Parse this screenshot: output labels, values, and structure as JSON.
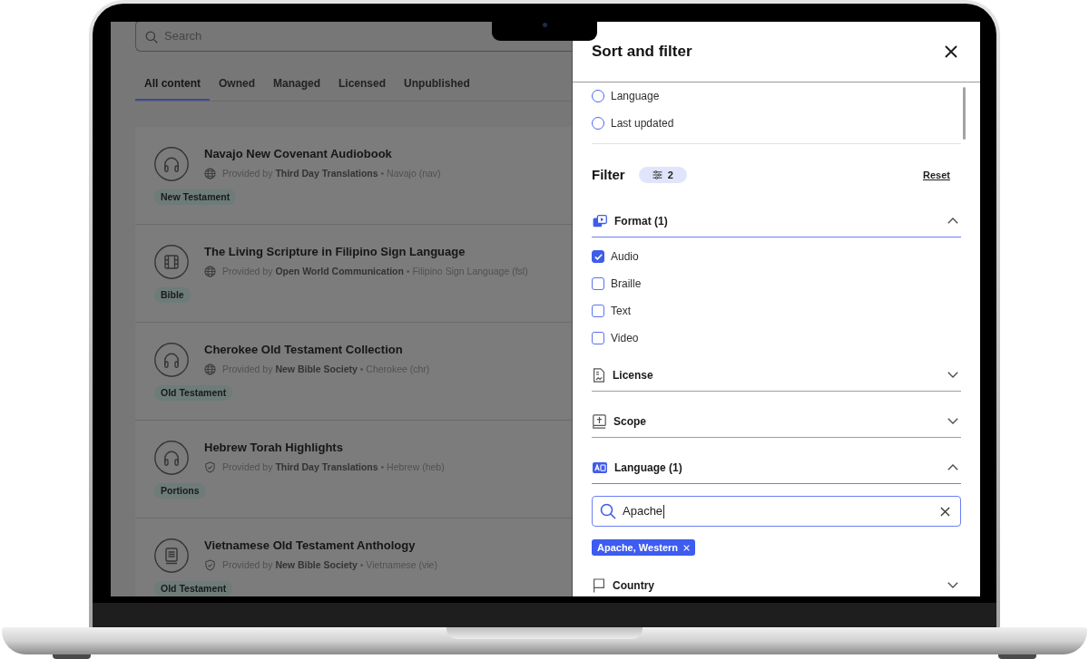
{
  "app": {
    "search": {
      "placeholder": "Search"
    },
    "tabs": [
      {
        "label": "All content",
        "selected": true
      },
      {
        "label": "Owned",
        "selected": false
      },
      {
        "label": "Managed",
        "selected": false
      },
      {
        "label": "Licensed",
        "selected": false
      },
      {
        "label": "Unpublished",
        "selected": false
      }
    ],
    "items": [
      {
        "title": "Navajo New Covenant Audiobook",
        "kind": "audio",
        "verified": false,
        "meta": "Provided by **Third Day Translations** • Navajo (nav)",
        "tag": "New Testament"
      },
      {
        "title": "The Living Scripture in Filipino Sign Language",
        "kind": "video",
        "verified": false,
        "meta": "Provided by **Open World Communication** • Filipino Sign Language (fsl)",
        "tag": "Bible"
      },
      {
        "title": "Cherokee Old Testament Collection",
        "kind": "audio",
        "verified": false,
        "meta": "Provided by **New Bible Society** • Cherokee (chr)",
        "tag": "Old Testament"
      },
      {
        "title": "Hebrew Torah Highlights",
        "kind": "audio",
        "verified": true,
        "meta": "Provided by **Third Day Translations** • Hebrew (heb)",
        "tag": "Portions"
      },
      {
        "title": "Vietnamese Old Testament Anthology",
        "kind": "text",
        "verified": true,
        "meta": "Provided by **New Bible Society** • Vietnamese (vie)",
        "tag": "Old Testament"
      }
    ]
  },
  "panel": {
    "title": "Sort and filter",
    "sort_options": [
      {
        "label": "Language",
        "selected": false
      },
      {
        "label": "Last updated",
        "selected": false
      }
    ],
    "filter": {
      "title": "Filter",
      "count": "2",
      "reset": "Reset"
    },
    "sections": [
      {
        "label": "Format (1)",
        "kind": "format",
        "expanded": true,
        "options": [
          {
            "label": "Audio",
            "checked": true
          },
          {
            "label": "Braille",
            "checked": false
          },
          {
            "label": "Text",
            "checked": false
          },
          {
            "label": "Video",
            "checked": false
          }
        ]
      },
      {
        "label": "License",
        "kind": "license",
        "expanded": false
      },
      {
        "label": "Scope",
        "kind": "scope",
        "expanded": false
      },
      {
        "label": "Language (1)",
        "kind": "language",
        "expanded": true,
        "search": {
          "value": "Apache"
        },
        "chips": [
          {
            "label": "Apache, Western"
          }
        ]
      },
      {
        "label": "Country",
        "kind": "country",
        "expanded": false
      }
    ]
  }
}
